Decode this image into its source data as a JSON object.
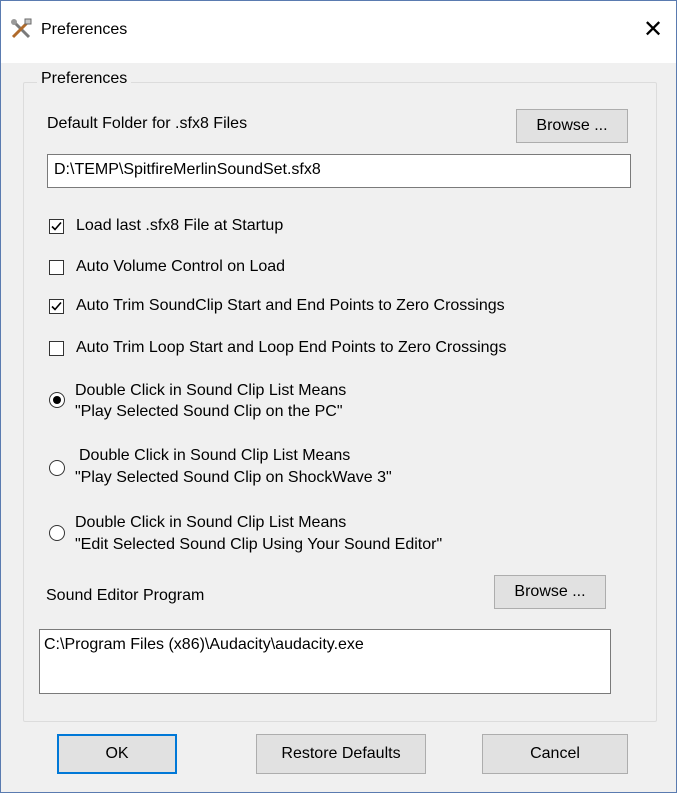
{
  "window": {
    "title": "Preferences",
    "icon": "tools-icon",
    "close_glyph": "✕"
  },
  "group": {
    "legend": "Preferences"
  },
  "default_folder": {
    "label": "Default Folder for .sfx8 Files",
    "browse_label": "Browse ...",
    "value": "D:\\TEMP\\SpitfireMerlinSoundSet.sfx8"
  },
  "checkboxes": [
    {
      "label": "Load last .sfx8 File at Startup",
      "checked": true
    },
    {
      "label": "Auto Volume Control on Load",
      "checked": false
    },
    {
      "label": "Auto Trim SoundClip Start and End Points to Zero Crossings",
      "checked": true
    },
    {
      "label": "Auto Trim Loop Start and Loop End Points to Zero Crossings",
      "checked": false
    }
  ],
  "radios": [
    {
      "line1": "Double Click in Sound Clip List Means",
      "line2": "\"Play Selected Sound Clip on the PC\"",
      "selected": true
    },
    {
      "line1": "Double Click in Sound Clip List Means",
      "line2": "\"Play Selected Sound Clip on ShockWave 3\"",
      "selected": false
    },
    {
      "line1": "Double Click in Sound Clip List Means",
      "line2": "\"Edit Selected Sound Clip Using Your Sound Editor\"",
      "selected": false
    }
  ],
  "sound_editor": {
    "label": "Sound Editor Program",
    "browse_label": "Browse ...",
    "value": "C:\\Program Files (x86)\\Audacity\\audacity.exe"
  },
  "footer": {
    "ok_label": "OK",
    "restore_label": "Restore Defaults",
    "cancel_label": "Cancel"
  },
  "colors": {
    "accent": "#0078d7",
    "dialog_bg": "#f0f0f0",
    "button_bg": "#e1e1e1"
  }
}
